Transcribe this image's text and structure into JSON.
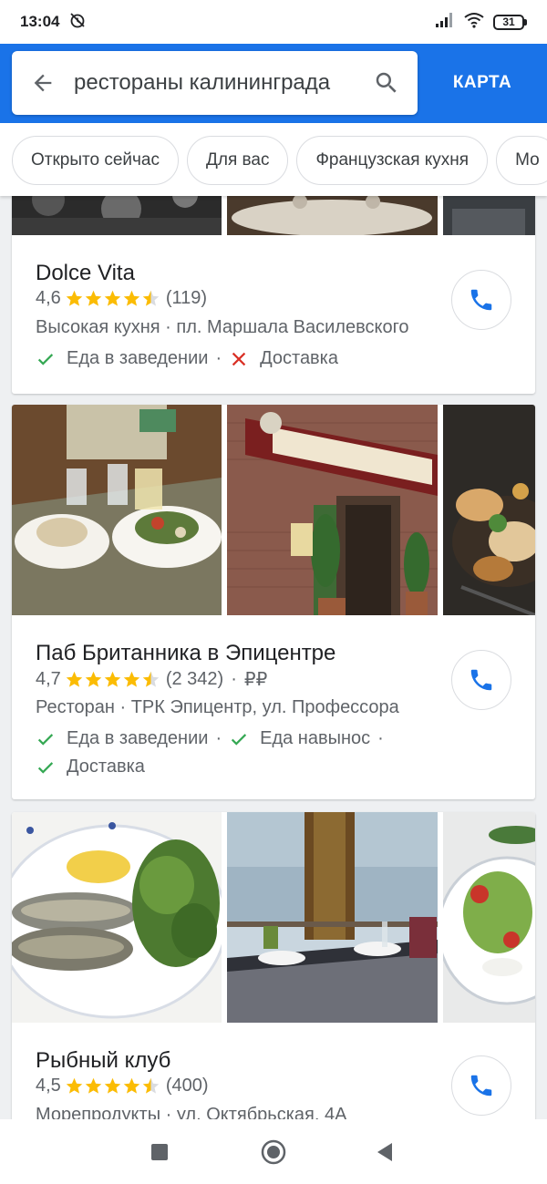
{
  "status_bar": {
    "time": "13:04",
    "battery": "31"
  },
  "search": {
    "query": "рестораны калининграда"
  },
  "map_button": "КАРТА",
  "chips": [
    "Открыто сейчас",
    "Для вас",
    "Французская кухня",
    "Мо"
  ],
  "results": [
    {
      "name": "Dolce Vita",
      "rating": "4,6",
      "stars": 4.5,
      "reviews": "(119)",
      "price": "",
      "category_address": "Высокая кухня · пл. Маршала Василевского",
      "services_line1": [
        {
          "label": "Еда в заведении",
          "available": true
        },
        {
          "label": "Доставка",
          "available": false
        }
      ],
      "services_line2": []
    },
    {
      "name": "Паб Британника в Эпицентре",
      "rating": "4,7",
      "stars": 4.5,
      "reviews": "(2 342)",
      "price": "₽₽",
      "category_address": "Ресторан · ТРК Эпицентр, ул. Профессора",
      "services_line1": [
        {
          "label": "Еда в заведении",
          "available": true
        },
        {
          "label": "Еда навынос",
          "available": true
        }
      ],
      "services_line2": [
        {
          "label": "Доставка",
          "available": true
        }
      ]
    },
    {
      "name": "Рыбный клуб",
      "rating": "4,5",
      "stars": 4.5,
      "reviews": "(400)",
      "price": "",
      "category_address": "Морепродукты · ул. Октябрьская, 4А",
      "services_line1": [],
      "services_line2": []
    }
  ],
  "colors": {
    "accent": "#1a73e8",
    "star": "#fbbc04",
    "check": "#34a853",
    "cross": "#d93025",
    "text_secondary": "#5f6368"
  }
}
